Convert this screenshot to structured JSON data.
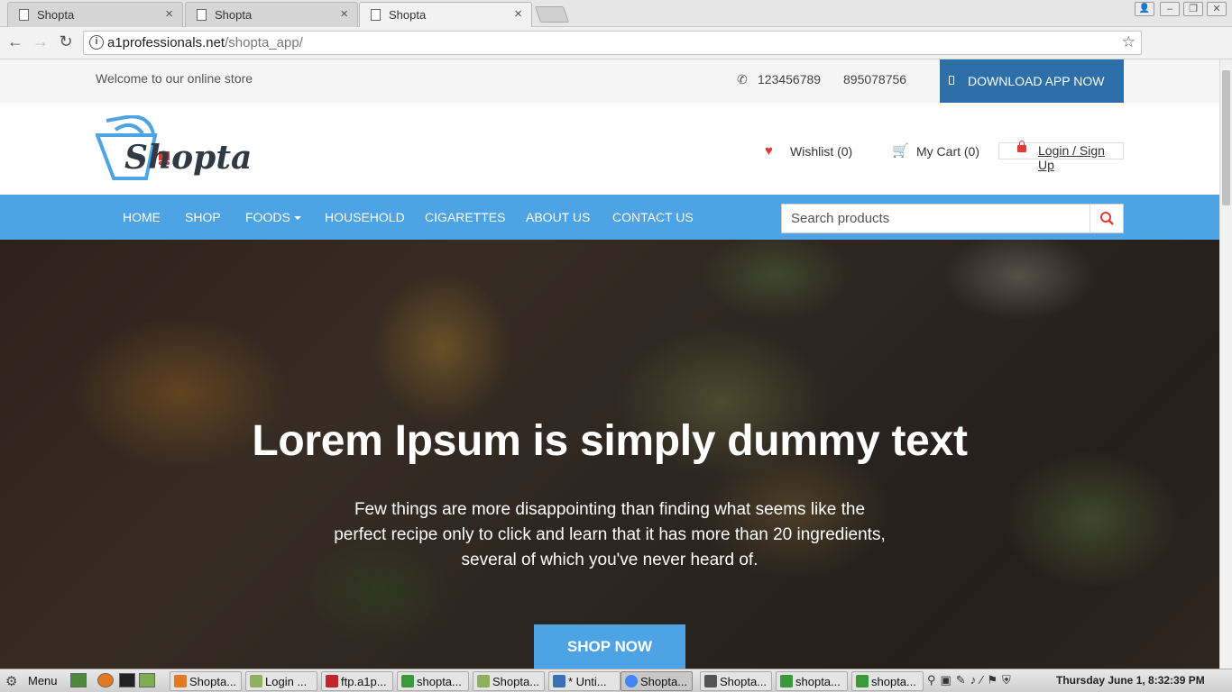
{
  "browser": {
    "tabs": [
      {
        "label": "Shopta",
        "active": false
      },
      {
        "label": "Shopta",
        "active": false
      },
      {
        "label": "Shopta",
        "active": true
      }
    ],
    "url_host": "a1professionals.net",
    "url_path": "/shopta_app/"
  },
  "topbar": {
    "welcome": "Welcome to our online store",
    "phone1": "123456789",
    "phone2": "895078756",
    "download_label": "DOWNLOAD APP NOW"
  },
  "header": {
    "logo_text": "Shopta",
    "wishlist": "Wishlist (0)",
    "cart": "My Cart (0)",
    "login": "Login / Sign Up"
  },
  "nav": {
    "items": [
      "HOME",
      "SHOP",
      "FOODS",
      "HOUSEHOLD",
      "CIGARETTES",
      "ABOUT US",
      "CONTACT US"
    ],
    "search_placeholder": "Search products"
  },
  "hero": {
    "title": "Lorem Ipsum is simply dummy text",
    "subtitle": "Few things are more disappointing than finding what seems like the perfect recipe only to click and learn that it has more than 20 ingredients, several of which you've never heard of.",
    "cta": "SHOP NOW"
  },
  "taskbar": {
    "menu_label": "Menu",
    "tasks": [
      "Shopta...",
      "Login ...",
      "ftp.a1p...",
      "shopta...",
      "Shopta...",
      "* Unti...",
      "Shopta...",
      "Shopta...",
      "shopta...",
      "shopta..."
    ],
    "clock": "Thursday June  1,  8:32:39 PM"
  },
  "colors": {
    "accent": "#4da3e3",
    "download_bg": "#2d6fa8",
    "icon_red": "#e53935"
  }
}
